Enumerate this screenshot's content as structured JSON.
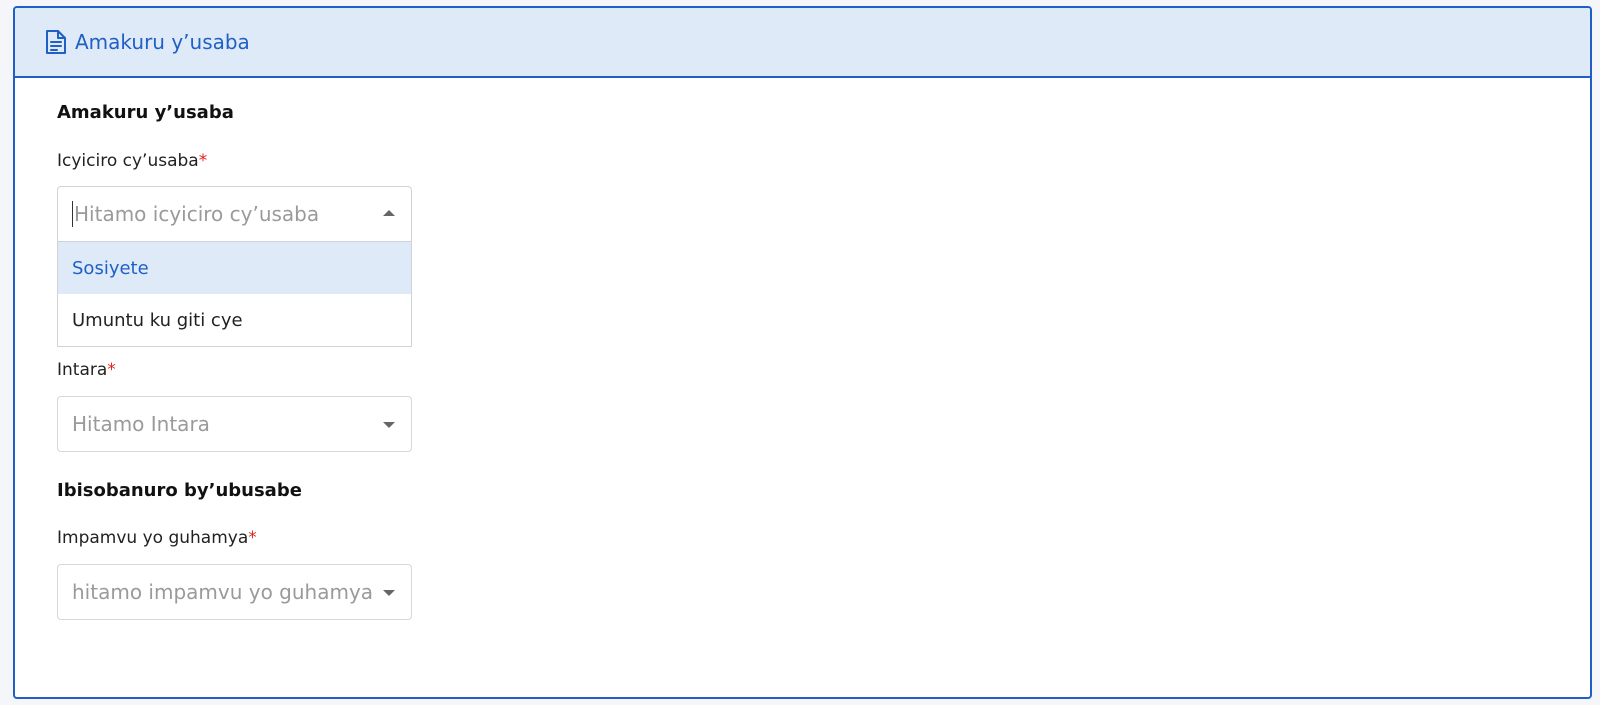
{
  "header": {
    "icon": "document-icon",
    "title": "Amakuru y’usaba",
    "accent_color": "#1f5fc6",
    "bg_color": "#deeaf7"
  },
  "sections": {
    "applicant": {
      "title": "Amakuru y’usaba",
      "category": {
        "label": "Icyiciro cy’usaba",
        "required_mark": "*",
        "placeholder": "Hitamo icyiciro cy’usaba",
        "open": true,
        "options": [
          "Sosiyete",
          "Umuntu ku giti cye"
        ],
        "highlighted_option": "Sosiyete"
      },
      "province": {
        "label": "Intara",
        "required_mark": "*",
        "placeholder": "Hitamo Intara"
      }
    },
    "request": {
      "title": "Ibisobanuro by’ubusabe",
      "reason": {
        "label": "Impamvu yo guhamya",
        "required_mark": "*",
        "placeholder": "hitamo impamvu yo guhamya"
      }
    }
  }
}
